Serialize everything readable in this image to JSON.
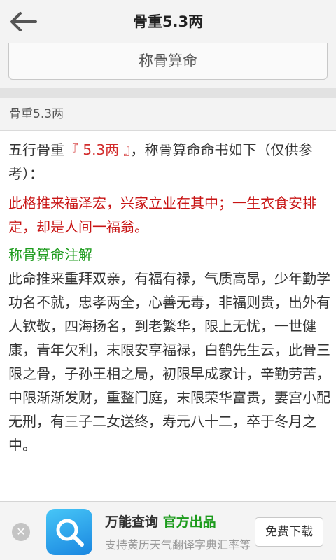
{
  "header": {
    "title": "骨重5.3两",
    "back_icon": "back-arrow-icon"
  },
  "action": {
    "button_label": "称骨算命"
  },
  "section": {
    "heading": "骨重5.3两"
  },
  "content": {
    "intro_prefix": "五行骨重",
    "intro_highlight": "『 5.3两 』",
    "intro_suffix": "，称骨算命命书如下（仅供参考）：",
    "verse": "此格推来福泽宏，兴家立业在其中；一生衣食安排定，却是人间一福翁。",
    "subtitle": "称骨算命注解",
    "detail": "此命推来重拜双亲，有福有禄，气质高昂，少年勤学功名不就，忠孝两全，心善无毒，非福则贵，出外有人钦敬，四海扬名，到老繁华，限上无忧，一世健康，青年欠利，末限安享福禄，白鹤先生云，此骨三限之骨，子孙王相之局，初限早成家计，辛勤劳苦，中限渐渐发财，重整门庭，末限荣华富贵，妻宫小配无刑，有三子二女送终，寿元八十二，卒于冬月之中。"
  },
  "ad": {
    "close_symbol": "✕",
    "app_name": "万能查询",
    "tag": "官方出品",
    "description": "支持黄历天气翻译字典汇率等",
    "download_label": "免费下载"
  },
  "colors": {
    "verse": "#c81414",
    "highlight": "#d22c2c",
    "subtitle": "#1c9b1c"
  }
}
